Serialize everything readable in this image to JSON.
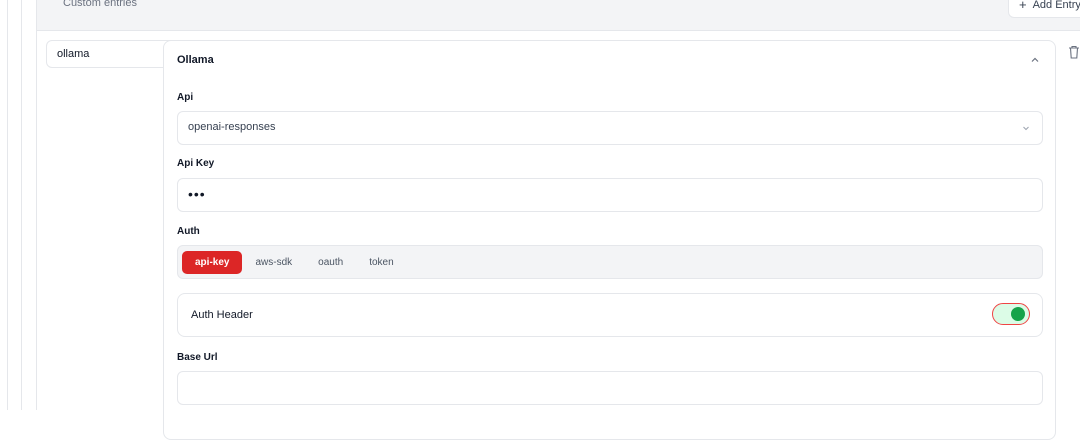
{
  "section": {
    "title": "Custom entries",
    "add_entry_label": "Add Entry"
  },
  "entry": {
    "key": "ollama"
  },
  "card": {
    "title": "Ollama",
    "api": {
      "label": "Api",
      "value": "openai-responses"
    },
    "api_key": {
      "label": "Api Key",
      "value": "•••"
    },
    "auth": {
      "label": "Auth",
      "options": [
        "api-key",
        "aws-sdk",
        "oauth",
        "token"
      ],
      "selected": "api-key"
    },
    "auth_header": {
      "label": "Auth Header",
      "enabled": true
    },
    "base_url": {
      "label": "Base Url",
      "value": ""
    }
  },
  "colors": {
    "accent": "#dc2626",
    "toggle_on": "#16a34a"
  }
}
